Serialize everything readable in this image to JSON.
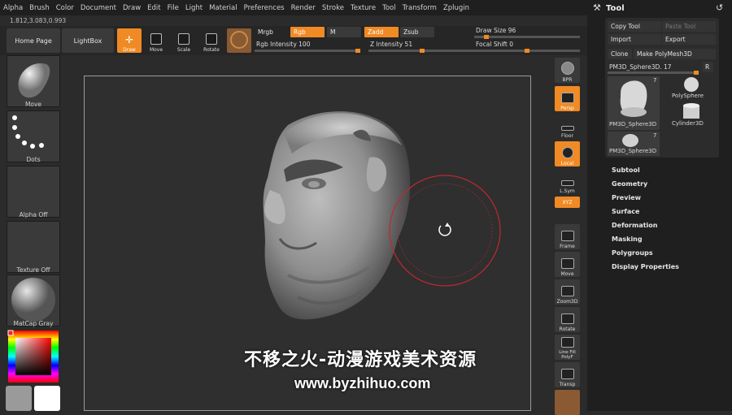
{
  "menu": [
    "Alpha",
    "Brush",
    "Color",
    "Document",
    "Draw",
    "Edit",
    "File",
    "Light",
    "Material",
    "Preferences",
    "Render",
    "Stroke",
    "Texture",
    "Tool",
    "Transform",
    "Zplugin"
  ],
  "coords": "1.812,3.083,0.993",
  "topbar": {
    "home_page": "Home Page",
    "lightbox": "LightBox",
    "tools": [
      {
        "label": "Draw",
        "icon": "draw-icon",
        "active": true
      },
      {
        "label": "Move",
        "icon": "move-icon",
        "active": false
      },
      {
        "label": "Scale",
        "icon": "scale-icon",
        "active": false
      },
      {
        "label": "Rotate",
        "icon": "rotate-icon",
        "active": false
      }
    ],
    "mrgb": "Mrgb",
    "rgb": "Rgb",
    "m": "M",
    "zadd": "Zadd",
    "zsub": "Zsub",
    "rgb_intensity": "Rgb Intensity 100",
    "z_intensity": "Z Intensity 51",
    "draw_size": "Draw Size 96",
    "focal_shift": "Focal Shift 0",
    "rgb_intensity_value": 100,
    "z_intensity_value": 51,
    "draw_size_value": 96,
    "focal_shift_value": 0
  },
  "left_shelf": [
    {
      "caption": "Move",
      "icon": "move-brush-icon"
    },
    {
      "caption": "Dots",
      "icon": "dots-stroke-icon"
    },
    {
      "caption": "Alpha Off",
      "icon": "alpha-icon"
    },
    {
      "caption": "Texture Off",
      "icon": "texture-icon"
    },
    {
      "caption": "MatCap Gray",
      "icon": "matcap-sphere-icon"
    }
  ],
  "right_shelf": [
    {
      "label": "BPR",
      "icon": "bpr-icon",
      "active": false
    },
    {
      "label": "Persp",
      "icon": "persp-icon",
      "active": true
    },
    {
      "label": "Floor",
      "icon": "floor-icon",
      "active": false
    },
    {
      "label": "Local",
      "icon": "local-icon",
      "active": true
    },
    {
      "label": "L.Sym",
      "icon": "lsym-icon",
      "active": false
    },
    {
      "label": "XYZ",
      "icon": "xyz-icon",
      "active": true
    },
    {
      "label": "Frame",
      "icon": "frame-icon",
      "active": false
    },
    {
      "label": "Move",
      "icon": "move-view-icon",
      "active": false
    },
    {
      "label": "Zoom3D",
      "icon": "zoom3d-icon",
      "active": false
    },
    {
      "label": "Rotate",
      "icon": "rotate-view-icon",
      "active": false
    },
    {
      "label": "Line Fill PolyF",
      "icon": "polyf-icon",
      "active": false
    },
    {
      "label": "Transp",
      "icon": "transp-icon",
      "active": false
    }
  ],
  "tool_panel": {
    "title": "Tool",
    "copy_tool": "Copy Tool",
    "paste_tool": "Paste Tool",
    "import": "Import",
    "export": "Export",
    "clone": "Clone",
    "make_polymesh": "Make PolyMesh3D",
    "current_tool": "PM3D_Sphere3D. 17",
    "r_button": "R",
    "thumb_main": "PM3D_Sphere3D",
    "thumb_main_count": "7",
    "polysphere": "PolySphere",
    "cylinder": "Cylinder3D",
    "thumb_small": "PM3D_Sphere3D",
    "thumb_small_count": "7",
    "subpalettes": [
      "Subtool",
      "Geometry",
      "Preview",
      "Surface",
      "Deformation",
      "Masking",
      "Polygroups",
      "Display Properties"
    ]
  },
  "watermark": {
    "line1": "不移之火-动漫游戏美术资源",
    "line2": "www.byzhihuo.com"
  },
  "colors": {
    "accent": "#f08a24",
    "brush_circle": "#c0282d"
  }
}
